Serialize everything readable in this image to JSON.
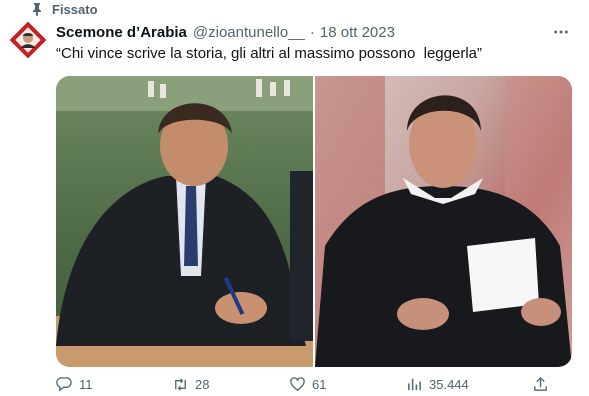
{
  "pinned": {
    "label": "Fissato"
  },
  "tweet": {
    "display_name": "Scemone d’Arabia",
    "handle": "@zioantunello__",
    "separator": "·",
    "date": "18 ott 2023",
    "text": "“Chi vince scrive la storia, gli altri al massimo possono  leggerla”"
  },
  "actions": {
    "replies": "11",
    "retweets": "28",
    "likes": "61",
    "views": "35.444"
  },
  "icons": {
    "pin": "pin-icon",
    "more": "more-icon",
    "reply": "reply-icon",
    "retweet": "retweet-icon",
    "like": "heart-icon",
    "views": "views-icon",
    "share": "share-icon"
  }
}
